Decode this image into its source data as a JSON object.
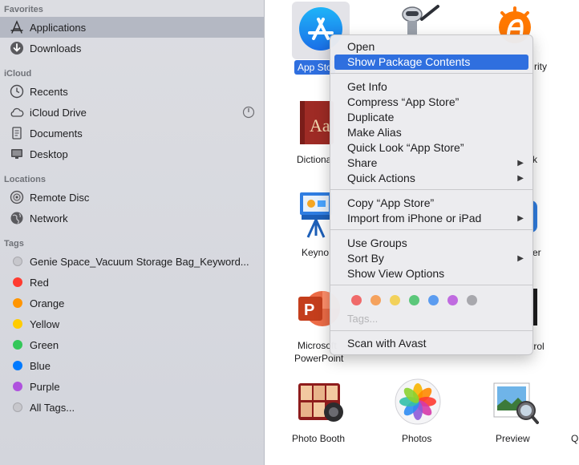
{
  "sidebar": {
    "favorites_title": "Favorites",
    "favorites": [
      {
        "label": "Applications",
        "icon": "applications-icon",
        "selected": true
      },
      {
        "label": "Downloads",
        "icon": "downloads-icon"
      }
    ],
    "icloud_title": "iCloud",
    "icloud": [
      {
        "label": "Recents",
        "icon": "clock-icon"
      },
      {
        "label": "iCloud Drive",
        "icon": "cloud-icon"
      },
      {
        "label": "Documents",
        "icon": "document-icon"
      },
      {
        "label": "Desktop",
        "icon": "desktop-icon"
      }
    ],
    "locations_title": "Locations",
    "locations": [
      {
        "label": "Remote Disc",
        "icon": "disc-icon"
      },
      {
        "label": "Network",
        "icon": "globe-icon"
      }
    ],
    "tags_title": "Tags",
    "tags": [
      {
        "label": "Genie Space_Vacuum Storage Bag_Keyword...",
        "color": "#c7c7cc"
      },
      {
        "label": "Red",
        "color": "#ff3b30"
      },
      {
        "label": "Orange",
        "color": "#ff9500"
      },
      {
        "label": "Yellow",
        "color": "#ffcc00"
      },
      {
        "label": "Green",
        "color": "#34c759"
      },
      {
        "label": "Blue",
        "color": "#007aff"
      },
      {
        "label": "Purple",
        "color": "#af52de"
      },
      {
        "label": "All Tags...",
        "color": "#c7c7cc"
      }
    ]
  },
  "apps": [
    {
      "label": "App Store",
      "icon": "app-store-icon",
      "selected": true
    },
    {
      "label": "Automator",
      "icon": "automator-icon"
    },
    {
      "label": "Avast Security",
      "icon": "avast-icon"
    },
    {
      "label": "Dictionary",
      "icon": "dictionary-icon"
    },
    {
      "label": "Keynote",
      "icon": "keynote-icon"
    },
    {
      "label": "Microsoft PowerPoint",
      "line1": "Microsoft",
      "line2": "PowerPoint",
      "icon": "powerpoint-icon"
    },
    {
      "label": "Photo Booth",
      "icon": "photo-booth-icon"
    },
    {
      "label": "Photos",
      "icon": "photos-icon"
    },
    {
      "label": "Preview",
      "icon": "preview-icon"
    }
  ],
  "partial_labels": {
    "app_store": "App Sto",
    "dictionary": "Dictiona",
    "keynote": "Keyno",
    "avast": "rity",
    "col3_row2": "k",
    "col3_row3": "er",
    "col3_row4": "trol",
    "edge_row5": "Q"
  },
  "context_menu": {
    "items": [
      {
        "label": "Open"
      },
      {
        "label": "Show Package Contents",
        "highlighted": true
      },
      {
        "label": "Get Info"
      },
      {
        "label": "Compress “App Store”"
      },
      {
        "label": "Duplicate"
      },
      {
        "label": "Make Alias"
      },
      {
        "label": "Quick Look “App Store”"
      },
      {
        "label": "Share",
        "submenu": true
      },
      {
        "label": "Quick Actions",
        "submenu": true
      },
      {
        "label": "Copy “App Store”"
      },
      {
        "label": "Import from iPhone or iPad",
        "submenu": true
      },
      {
        "label": "Use Groups"
      },
      {
        "label": "Sort By",
        "submenu": true
      },
      {
        "label": "Show View Options"
      },
      {
        "label": "Scan with Avast"
      }
    ],
    "submenu_arrow": "▶",
    "tag_colors": [
      "#f06a6a",
      "#f5a25d",
      "#f2d15b",
      "#5bc77a",
      "#5b9cf0",
      "#c06be0",
      "#a8a8ad"
    ],
    "tags_placeholder": "Tags..."
  },
  "colors": {
    "accent": "#2f6fdf",
    "sidebar_bg": "#d6d8de",
    "selected_row": "#b4b8c3"
  }
}
